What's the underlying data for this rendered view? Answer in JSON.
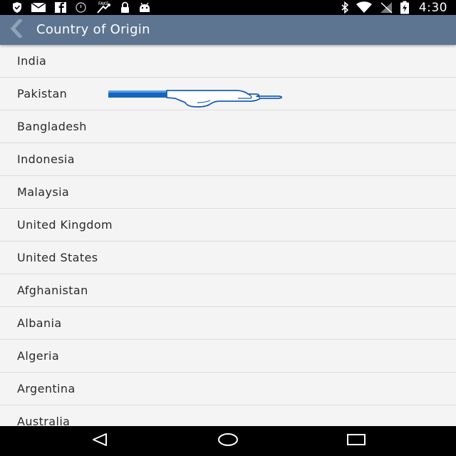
{
  "status_bar": {
    "time": "4:30",
    "left_icons": [
      "shield-icon",
      "mail-icon",
      "facebook-icon",
      "alarm-off-icon",
      "fake-gps-icon",
      "lock-icon",
      "android-icon"
    ],
    "right_icons": [
      "bluetooth-icon",
      "wifi-icon",
      "signal-off-icon",
      "battery-charging-icon"
    ]
  },
  "action_bar": {
    "title": "Country of Origin",
    "back_icon": "chevron-left-icon",
    "background_color": "#5d7591"
  },
  "countries": [
    "India",
    "Pakistan",
    "Bangladesh",
    "Indonesia",
    "Malaysia",
    "United Kingdom",
    "United States",
    "Afghanistan",
    "Albania",
    "Algeria",
    "Argentina",
    "Australia"
  ],
  "overlay": {
    "icon": "pointing-hand-icon",
    "target": "Pakistan",
    "color": "#1565c0"
  },
  "nav_bar": {
    "icons": [
      "nav-back-icon",
      "nav-home-icon",
      "nav-recent-icon"
    ]
  }
}
